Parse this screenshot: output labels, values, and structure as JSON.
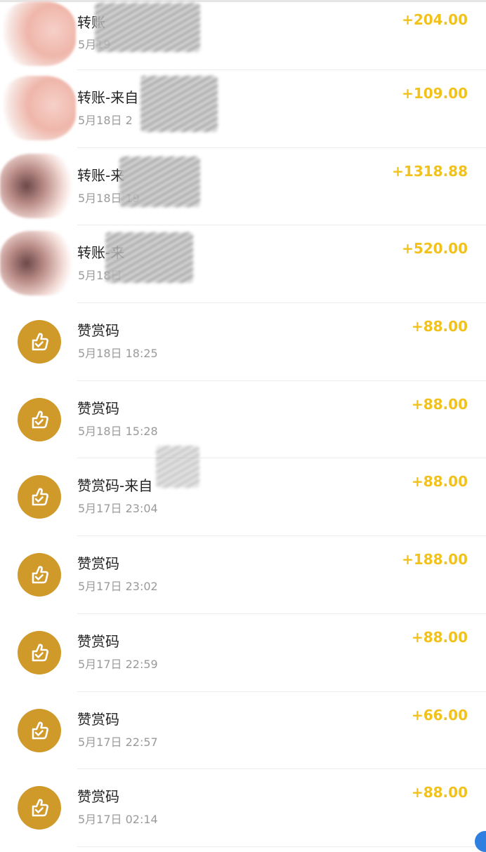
{
  "colors": {
    "amount": "#f2c21b",
    "appreciation_icon_bg": "#d09a2a",
    "title": "#222222",
    "timestamp": "#9a9a9a"
  },
  "transactions": [
    {
      "avatar": "blurred-photo",
      "title": "转账",
      "time": "5月19",
      "amount": "+204.00"
    },
    {
      "avatar": "blurred-photo",
      "title": "转账-来自",
      "time": "5月18日 2",
      "amount": "+109.00"
    },
    {
      "avatar": "blurred-photo",
      "title": "转账-来",
      "time": "5月18日 19",
      "amount": "+1318.88"
    },
    {
      "avatar": "blurred-photo",
      "title": "转账-来",
      "time": "5月18日",
      "amount": "+520.00"
    },
    {
      "avatar": "thumbs-up-icon",
      "title": "赞赏码",
      "time": "5月18日 18:25",
      "amount": "+88.00"
    },
    {
      "avatar": "thumbs-up-icon",
      "title": "赞赏码",
      "time": "5月18日 15:28",
      "amount": "+88.00"
    },
    {
      "avatar": "thumbs-up-icon",
      "title": "赞赏码-来自",
      "time": "5月17日 23:04",
      "amount": "+88.00"
    },
    {
      "avatar": "thumbs-up-icon",
      "title": "赞赏码",
      "time": "5月17日 23:02",
      "amount": "+188.00"
    },
    {
      "avatar": "thumbs-up-icon",
      "title": "赞赏码",
      "time": "5月17日 22:59",
      "amount": "+88.00"
    },
    {
      "avatar": "thumbs-up-icon",
      "title": "赞赏码",
      "time": "5月17日 22:57",
      "amount": "+66.00"
    },
    {
      "avatar": "thumbs-up-icon",
      "title": "赞赏码",
      "time": "5月17日 02:14",
      "amount": "+88.00"
    }
  ]
}
